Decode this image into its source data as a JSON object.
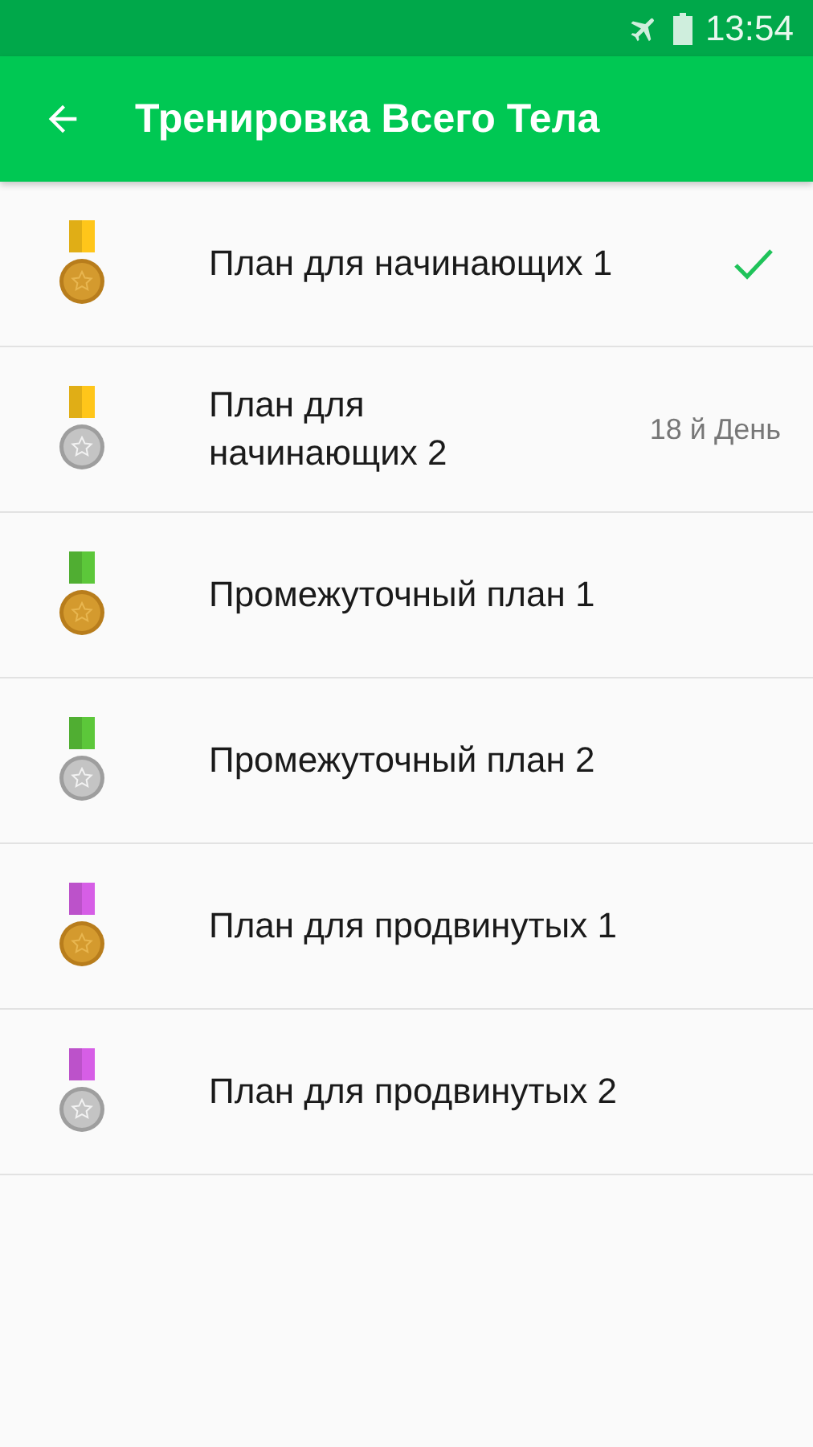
{
  "status_bar": {
    "time": "13:54"
  },
  "app_bar": {
    "title": "Тренировка Всего Тела"
  },
  "plans": [
    {
      "title": "План для начинающих 1",
      "kind": "bronze",
      "color": "#ffc61a",
      "completed": true
    },
    {
      "title": "План для начинающих 2",
      "kind": "silver",
      "color": "#ffc61a",
      "completed": false,
      "progress": "18 й День"
    },
    {
      "title": "Промежуточный план 1",
      "kind": "bronze",
      "color": "#5cc73a",
      "completed": false
    },
    {
      "title": "Промежуточный план 2",
      "kind": "silver",
      "color": "#5cc73a",
      "completed": false
    },
    {
      "title": "План для продвинутых 1",
      "kind": "bronze",
      "color": "#d65ee6",
      "completed": false
    },
    {
      "title": "План для продвинутых 2",
      "kind": "silver",
      "color": "#d65ee6",
      "completed": false
    }
  ]
}
